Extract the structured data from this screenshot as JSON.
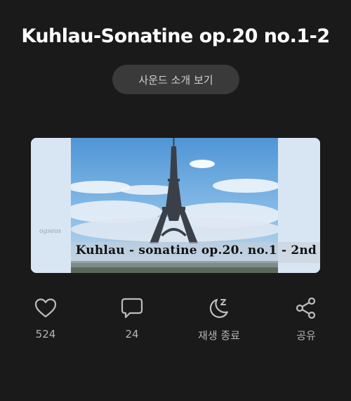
{
  "header": {
    "title": "Kuhlau-Sonatine op.20 no.1-2"
  },
  "intro_button": {
    "label": "사운드 소개 보기"
  },
  "thumbnail": {
    "caption": "Kuhlau - sonatine op.20. no.1 - 2nd",
    "watermark": "ogseos"
  },
  "actions": [
    {
      "icon": "heart-icon",
      "label": "524"
    },
    {
      "icon": "comment-icon",
      "label": "24"
    },
    {
      "icon": "moon-sleep-icon",
      "label": "재생 종료"
    },
    {
      "icon": "share-icon",
      "label": "공유"
    }
  ],
  "colors": {
    "background": "#1a1a1a",
    "text": "#ffffff",
    "muted": "#b5b5b5",
    "button": "#3a3a3a"
  }
}
